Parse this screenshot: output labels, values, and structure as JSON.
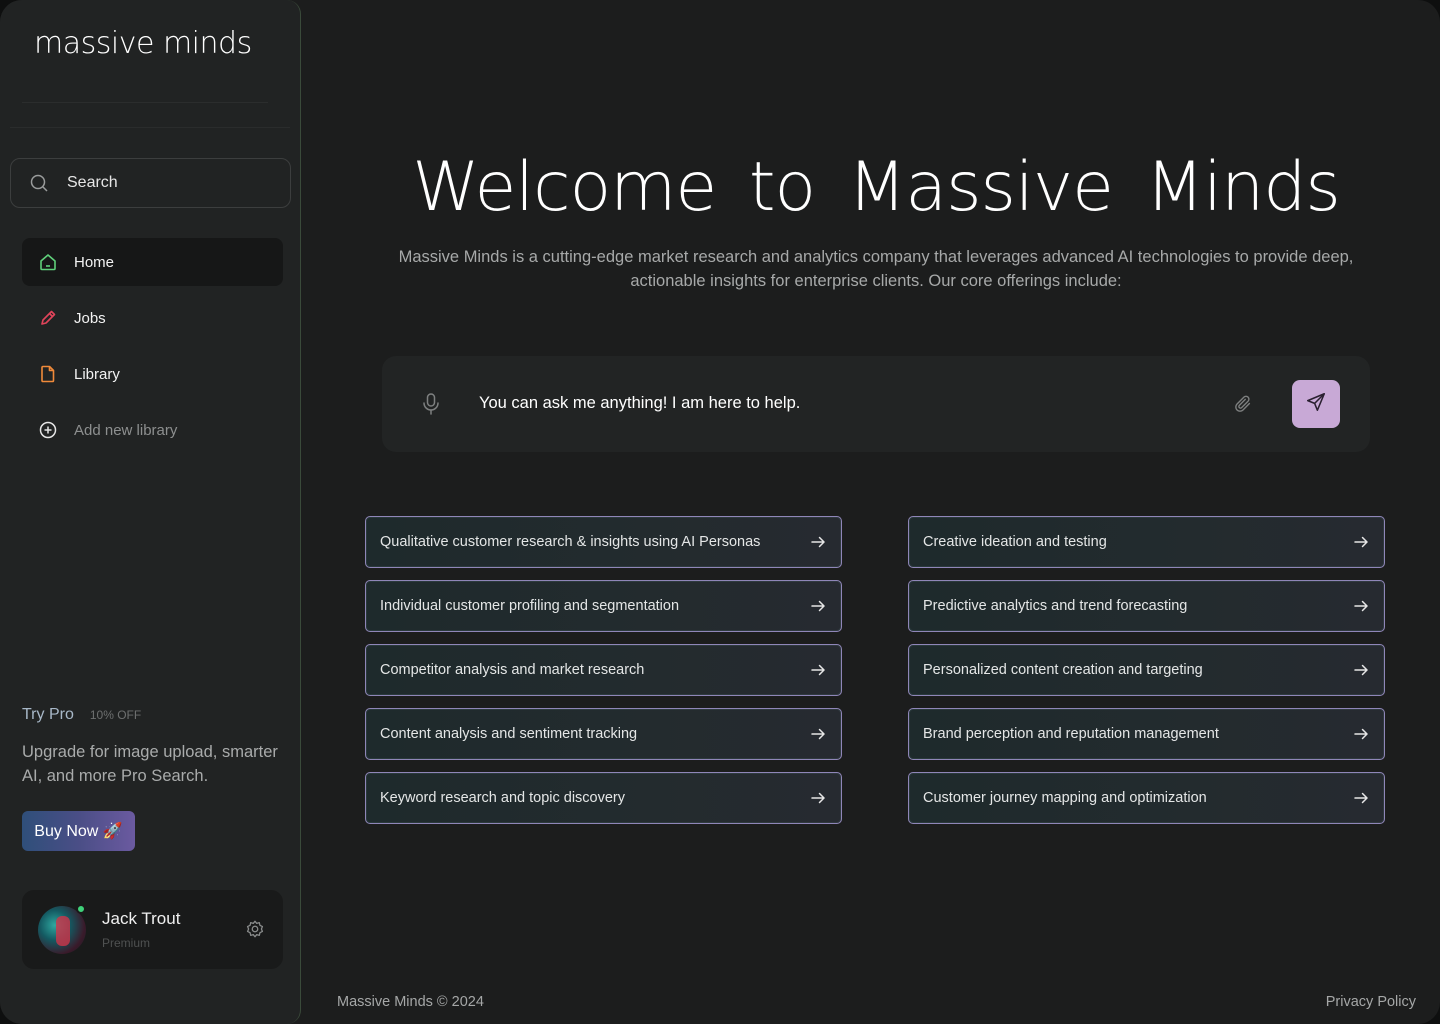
{
  "app": {
    "logo": "massive minds"
  },
  "sidebar": {
    "search_label": "Search",
    "nav": [
      {
        "label": "Home",
        "icon": "home-icon",
        "active": true,
        "color": "#5fd07a"
      },
      {
        "label": "Jobs",
        "icon": "pencil-icon",
        "active": false,
        "color": "#e0445a"
      },
      {
        "label": "Library",
        "icon": "file-icon",
        "active": false,
        "color": "#f08a3a"
      },
      {
        "label": "Add new library",
        "icon": "plus-circle-icon",
        "active": false,
        "color": "#e6e6e6"
      }
    ],
    "promo": {
      "title": "Try Pro",
      "badge": "10% OFF",
      "text": "Upgrade for image upload, smarter AI, and more Pro Search.",
      "button": "Buy Now 🚀"
    },
    "user": {
      "name": "Jack Trout",
      "plan": "Premium"
    }
  },
  "main": {
    "title": "Welcome to Massive Minds",
    "intro": "Massive Minds is a cutting-edge market research and analytics company that leverages advanced AI technologies to provide deep, actionable insights for enterprise clients. Our core offerings include:",
    "ask_placeholder": "You can ask me anything! I am here to help.",
    "offerings_left": [
      "Qualitative customer research & insights using AI Personas",
      "Individual customer profiling and segmentation",
      "Competitor analysis and market research",
      "Content analysis and sentiment tracking",
      "Keyword research and topic discovery"
    ],
    "offerings_right": [
      "Creative ideation and testing",
      "Predictive analytics and trend forecasting",
      "Personalized content creation and targeting",
      "Brand perception and reputation management",
      "Customer journey mapping and optimization"
    ]
  },
  "footer": {
    "copyright": "Massive Minds © 2024",
    "privacy": "Privacy Policy"
  },
  "colors": {
    "accent": "#c8a9d6",
    "online": "#3fd27a",
    "card_border": "#8f86b8"
  }
}
